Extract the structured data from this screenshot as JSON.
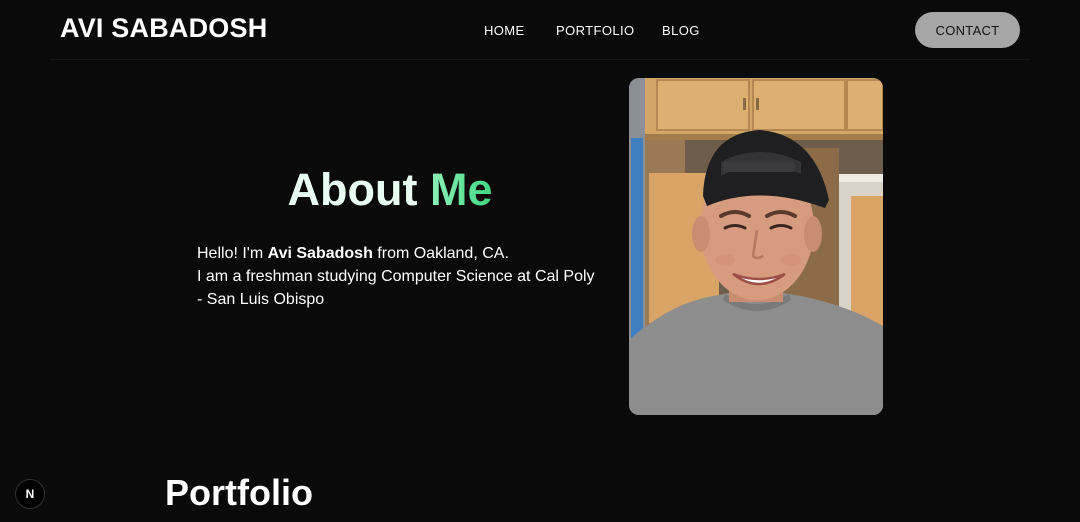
{
  "header": {
    "brand": "AVI SABADOSH",
    "nav": {
      "home": "HOME",
      "portfolio": "PORTFOLIO",
      "blog": "BLOG"
    },
    "contact_label": "CONTACT"
  },
  "about": {
    "title_word1": "About",
    "title_word2": "Me",
    "intro_prefix": "Hello! I'm ",
    "name": "Avi Sabadosh",
    "intro_suffix": " from Oakland, CA.",
    "line2": "I am a freshman studying Computer Science at Cal Poly",
    "line3": "- San Luis Obispo"
  },
  "portfolio": {
    "title": "Portfolio"
  },
  "dev_badge": {
    "letter": "N",
    "icon": "nextjs-logo-icon"
  },
  "colors": {
    "background": "#0a0a0a",
    "accent_green": "#3fd882",
    "contact_button": "#a6a6a6"
  }
}
